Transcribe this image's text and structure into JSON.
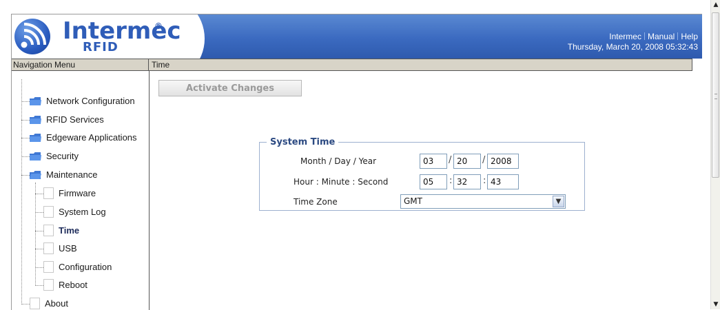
{
  "header": {
    "logo_name": "Intermec",
    "logo_reg": "®",
    "logo_sub": "RFID",
    "links": [
      "Intermec",
      "Manual",
      "Help"
    ],
    "datetime": "Thursday, March 20, 2008 05:32:43",
    "banner_color": "#3b6ac0"
  },
  "section_bar": {
    "nav_title": "Navigation Menu",
    "page_title": "Time"
  },
  "nav": {
    "folders": [
      {
        "label": "Network Configuration",
        "icon": "folder-icon"
      },
      {
        "label": "RFID Services",
        "icon": "folder-icon"
      },
      {
        "label": "Edgeware Applications",
        "icon": "folder-icon"
      },
      {
        "label": "Security",
        "icon": "folder-icon"
      },
      {
        "label": "Maintenance",
        "icon": "folder-icon"
      }
    ],
    "maintenance_items": [
      {
        "label": "Firmware"
      },
      {
        "label": "System Log"
      },
      {
        "label": "Time",
        "active": true
      },
      {
        "label": "USB"
      },
      {
        "label": "Configuration"
      },
      {
        "label": "Reboot"
      }
    ],
    "about": "About"
  },
  "main": {
    "activate_label": "Activate Changes",
    "legend": "System Time",
    "date_label": "Month / Day / Year",
    "time_label": "Hour : Minute : Second",
    "tz_label": "Time Zone",
    "month": "03",
    "day": "20",
    "year": "2008",
    "hour": "05",
    "minute": "32",
    "second": "43",
    "timezone": "GMT"
  }
}
